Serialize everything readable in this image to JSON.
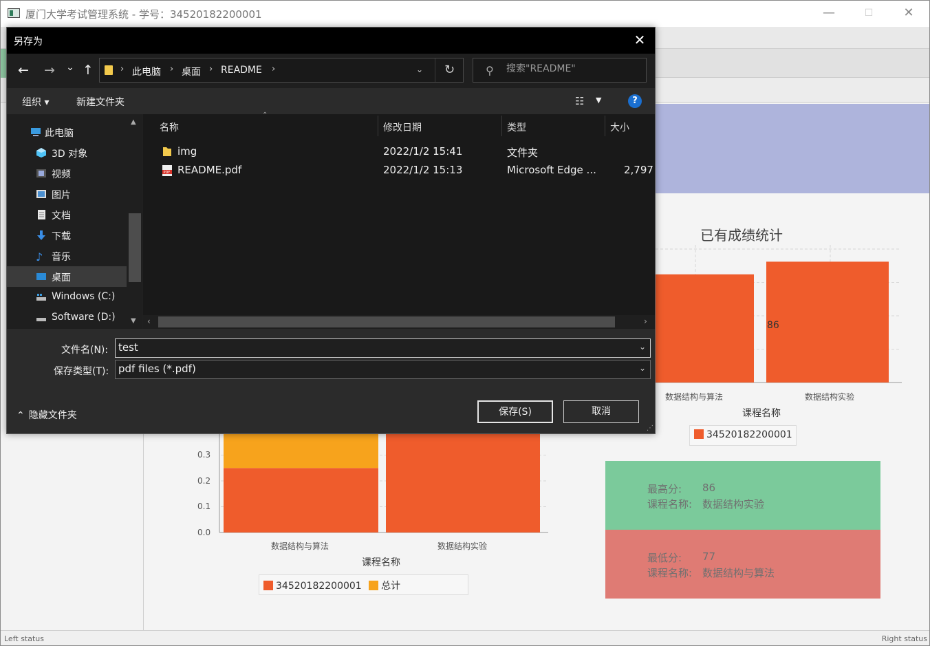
{
  "app": {
    "title": "厦门大学考试管理系统 - 学号：34520182200001",
    "status_left": "Left status",
    "status_right": "Right status",
    "window_controls": {
      "minimize": "—",
      "maximize": "☐",
      "close": "✕"
    }
  },
  "stats_chart": {
    "title": "已有成绩统计",
    "xlabel": "课程名称",
    "value_label": "86",
    "x_tick_labels": [
      "数据结构与算法",
      "数据结构实验"
    ],
    "legend": [
      "34520182200001"
    ]
  },
  "ratio_chart": {
    "xlabel": "课程名称",
    "y_tick_labels": [
      "0.3",
      "0.2",
      "0.1",
      "0.0"
    ],
    "x_tick_labels": [
      "数据结构与算法",
      "数据结构实验"
    ],
    "legend": [
      "34520182200001",
      "总计"
    ]
  },
  "chart_data": [
    {
      "type": "bar",
      "title": "已有成绩统计",
      "xlabel": "课程名称",
      "ylabel": "",
      "categories": [
        "数据结构与算法",
        "数据结构实验"
      ],
      "series": [
        {
          "name": "34520182200001",
          "values": [
            77,
            86
          ]
        }
      ],
      "colors": [
        "#ef5c2c"
      ],
      "ylim": [
        0,
        95
      ],
      "grid": true,
      "legend": "bottom"
    },
    {
      "type": "bar",
      "xlabel": "课程名称",
      "ylabel": "",
      "categories": [
        "数据结构与算法",
        "数据结构实验"
      ],
      "series": [
        {
          "name": "34520182200001",
          "values": [
            0.25,
            1.0
          ]
        },
        {
          "name": "总计",
          "values": [
            0.75,
            0.0
          ]
        }
      ],
      "stacked": true,
      "colors": [
        "#ef5c2c",
        "#f7a31c"
      ],
      "y_ticks": [
        0.0,
        0.1,
        0.2,
        0.3
      ],
      "ylim": [
        0,
        1.0
      ],
      "grid": true,
      "legend": "bottom"
    }
  ],
  "cards": {
    "max": {
      "score_label": "最高分:",
      "score": "86",
      "course_label": "课程名称:",
      "course": "数据结构实验",
      "color": "#7bca9b"
    },
    "min": {
      "score_label": "最低分:",
      "score": "77",
      "course_label": "课程名称:",
      "course": "数据结构与算法",
      "color": "#df7b74"
    }
  },
  "dialog": {
    "title": "另存为",
    "close": "✕",
    "nav": {
      "back": "←",
      "forward": "→",
      "recent": "⌄",
      "up": "↑"
    },
    "breadcrumbs": [
      "此电脑",
      "桌面",
      "README"
    ],
    "search_placeholder": "搜索\"README\"",
    "organize": "组织 ▾",
    "new_folder": "新建文件夹",
    "help": "?",
    "nav_tree": [
      {
        "label": "此电脑",
        "icon": "computer-icon"
      },
      {
        "label": "3D 对象",
        "icon": "cube-icon"
      },
      {
        "label": "视频",
        "icon": "video-icon"
      },
      {
        "label": "图片",
        "icon": "picture-icon"
      },
      {
        "label": "文档",
        "icon": "document-icon"
      },
      {
        "label": "下载",
        "icon": "download-icon"
      },
      {
        "label": "音乐",
        "icon": "music-icon"
      },
      {
        "label": "桌面",
        "icon": "desktop-icon"
      },
      {
        "label": "Windows (C:)",
        "icon": "drive-icon"
      },
      {
        "label": "Software (D:)",
        "icon": "drive-icon"
      }
    ],
    "columns": [
      "名称",
      "修改日期",
      "类型",
      "大小"
    ],
    "files": [
      {
        "name": "img",
        "date": "2022/1/2 15:41",
        "type": "文件夹",
        "size": "",
        "icon": "folder-icon"
      },
      {
        "name": "README.pdf",
        "date": "2022/1/2 15:13",
        "type": "Microsoft Edge ...",
        "size": "2,797",
        "icon": "pdf-icon"
      }
    ],
    "filename_label": "文件名(N):",
    "filename_value": "test",
    "filetype_label": "保存类型(T):",
    "filetype_value": "pdf files (*.pdf)",
    "save_button": "保存(S)",
    "cancel_button": "取消",
    "hide_folders": "隐藏文件夹"
  }
}
